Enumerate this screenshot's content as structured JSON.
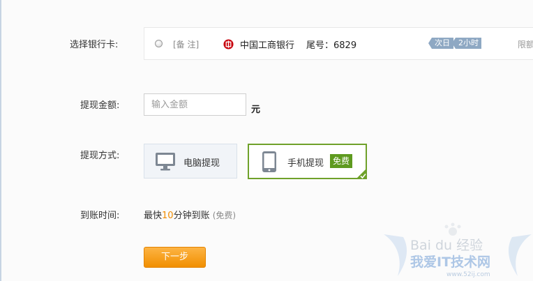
{
  "labels": {
    "bank_card": "选择银行卡:",
    "amount": "提现金额:",
    "method": "提现方式:",
    "arrival": "到账时间:"
  },
  "bank": {
    "note": "[备 注]",
    "name": "中国工商银行",
    "tail": "尾号：6829",
    "tags": [
      "次日",
      "2小时"
    ],
    "limit": "限额"
  },
  "amount": {
    "placeholder": "输入金额",
    "value": "",
    "unit": "元"
  },
  "methods": {
    "pc_label": "电脑提现",
    "mobile_label": "手机提现",
    "free_badge": "免费",
    "selected": "mobile"
  },
  "arrival": {
    "prefix": "最快",
    "minutes": "10",
    "suffix": "分钟到账",
    "note": "(免费)"
  },
  "next_button": "下一步",
  "watermark": {
    "text_top": "Bai du 经验",
    "text_bottom": "我爱IT技术网",
    "url": "www.52ij.com"
  },
  "colors": {
    "accent_green": "#6fa12a",
    "button_orange": "#f18f00",
    "tag_blue": "#8ea8c3",
    "highlight_orange": "#f08c00"
  }
}
